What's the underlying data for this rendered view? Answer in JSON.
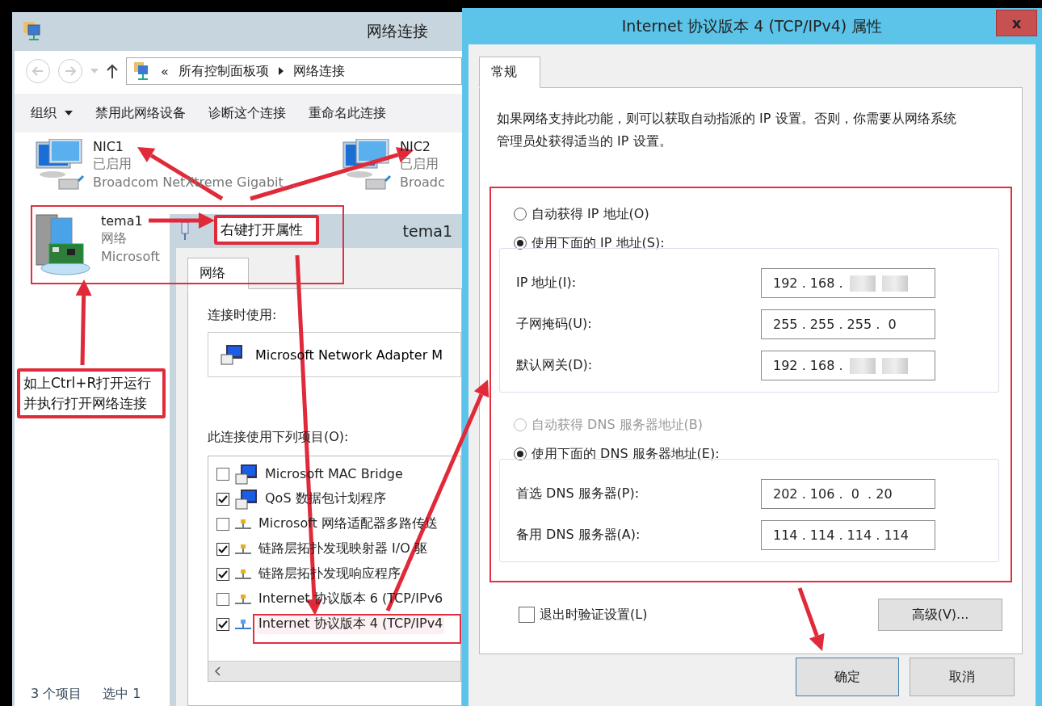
{
  "explorer": {
    "title": "网络连接",
    "address": {
      "prefix": "«",
      "segments": [
        "所有控制面板项",
        "网络连接"
      ]
    },
    "toolbar": [
      {
        "label": "组织",
        "dropdown": true
      },
      {
        "label": "禁用此网络设备",
        "dropdown": false
      },
      {
        "label": "诊断这个连接",
        "dropdown": false
      },
      {
        "label": "重命名此连接",
        "dropdown": false
      }
    ],
    "connections": [
      {
        "kind": "monitor",
        "name": "NIC1",
        "status": "已启用",
        "device": "Broadcom NetXtreme Gigabit ..."
      },
      {
        "kind": "monitor",
        "name": "NIC2",
        "status": "已启用",
        "device": "Broadc"
      },
      {
        "kind": "server",
        "name": "tema1",
        "status": "网络",
        "device": "Microsoft"
      }
    ],
    "status_bar": [
      "3 个项目",
      "选中 1"
    ]
  },
  "adapter_dialog": {
    "title": "tema1",
    "tabs": [
      {
        "label": "网络",
        "selected": true
      }
    ],
    "connect_using_label": "连接时使用:",
    "adapter": "Microsoft Network Adapter M",
    "items_label": "此连接使用下列项目(O):",
    "items": [
      {
        "kind": "computer",
        "label": "Microsoft MAC Bridge",
        "checked": false,
        "selected": false
      },
      {
        "kind": "computer",
        "label": "QoS 数据包计划程序",
        "checked": true,
        "selected": false
      },
      {
        "kind": "protocol",
        "label": "Microsoft 网络适配器多路传送",
        "checked": false,
        "selected": false
      },
      {
        "kind": "protocol",
        "label": "链路层拓扑发现映射器 I/O 驱",
        "checked": true,
        "selected": false
      },
      {
        "kind": "protocol",
        "label": "链路层拓扑发现响应程序",
        "checked": true,
        "selected": false
      },
      {
        "kind": "protocol",
        "label": "Internet 协议版本 6 (TCP/IPv6",
        "checked": false,
        "selected": false
      },
      {
        "kind": "protocol",
        "label": "Internet 协议版本 4 (TCP/IPv4",
        "checked": true,
        "selected": true
      }
    ]
  },
  "ipv4_dialog": {
    "title": "Internet 协议版本 4 (TCP/IPv4) 属性",
    "close": "x",
    "tabs": [
      {
        "label": "常规",
        "selected": true
      }
    ],
    "description": "如果网络支持此功能，则可以获取自动指派的 IP 设置。否则，你需要从网络系统管理员处获得适当的 IP 设置。",
    "ip_auto": {
      "label": "自动获得 IP 地址(O)",
      "selected": false,
      "disabled": false
    },
    "ip_manual": {
      "label": "使用下面的 IP 地址(S):",
      "selected": true,
      "disabled": false
    },
    "ip_fields": [
      {
        "label": "IP 地址(I):",
        "value": "192 . 168 .",
        "redacted": true
      },
      {
        "label": "子网掩码(U):",
        "value": "255 . 255 . 255 .  0",
        "redacted": false
      },
      {
        "label": "默认网关(D):",
        "value": "192 . 168 .",
        "redacted": true
      }
    ],
    "dns_auto": {
      "label": "自动获得 DNS 服务器地址(B)",
      "selected": false,
      "disabled": true
    },
    "dns_manual": {
      "label": "使用下面的 DNS 服务器地址(E):",
      "selected": true,
      "disabled": false
    },
    "dns_fields": [
      {
        "label": "首选 DNS 服务器(P):",
        "value": "202 . 106 .  0  . 20",
        "redacted": false
      },
      {
        "label": "备用 DNS 服务器(A):",
        "value": "114 . 114 . 114 . 114",
        "redacted": false
      }
    ],
    "validate": {
      "label": "退出时验证设置(L)",
      "checked": false
    },
    "advanced_button": "高级(V)...",
    "ok_button": "确定",
    "cancel_button": "取消"
  },
  "annotations": {
    "right_click_note": "右键打开属性",
    "run_note": [
      "如上Ctrl+R打开运行",
      "并执行打开网络连接"
    ]
  }
}
